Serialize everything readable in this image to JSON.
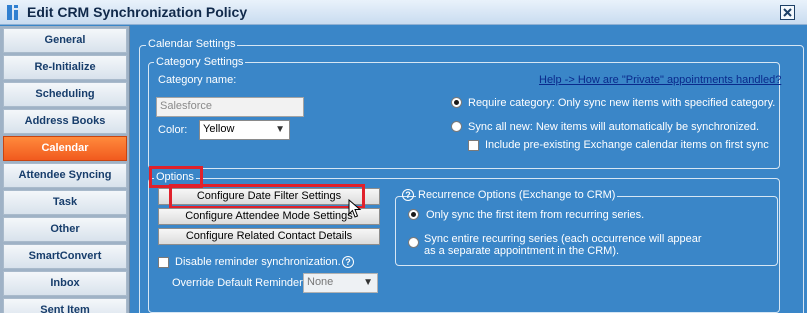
{
  "window": {
    "title": "Edit CRM Synchronization Policy"
  },
  "sidebar": {
    "items": [
      {
        "label": "General"
      },
      {
        "label": "Re-Initialize"
      },
      {
        "label": "Scheduling"
      },
      {
        "label": "Address Books"
      },
      {
        "label": "Calendar"
      },
      {
        "label": "Attendee Syncing"
      },
      {
        "label": "Task"
      },
      {
        "label": "Other"
      },
      {
        "label": "SmartConvert"
      },
      {
        "label": "Inbox"
      },
      {
        "label": "Sent Item"
      }
    ],
    "active": "Calendar"
  },
  "calendar_settings": {
    "legend": "Calendar Settings",
    "category_settings": {
      "legend": "Category Settings",
      "category_name_label": "Category name:",
      "category_name_value": "Salesforce",
      "color_label": "Color:",
      "color_value": "Yellow",
      "help_link": "Help -> How are \"Private\" appointments handled?",
      "require_category_label": "Require category: Only sync new items with specified category.",
      "sync_all_new_label": "Sync all new: New items will automatically be synchronized.",
      "include_preexisting_label": "Include pre-existing Exchange calendar items on first sync"
    },
    "options": {
      "legend": "Options",
      "configure_date_filter": "Configure Date Filter Settings",
      "configure_attendee_mode": "Configure Attendee Mode Settings",
      "configure_related_contact": "Configure Related Contact Details",
      "disable_reminder_label": "Disable reminder synchronization.",
      "override_reminder_label": "Override Default Reminder",
      "override_reminder_value": "None",
      "recurrence": {
        "legend": "Recurrence Options (Exchange to CRM)",
        "first_item_label": "Only sync the first item from recurring series.",
        "entire_series_line1": "Sync entire recurring series (each occurrence will appear",
        "entire_series_line2": "as a separate appointment in the CRM)."
      }
    }
  }
}
